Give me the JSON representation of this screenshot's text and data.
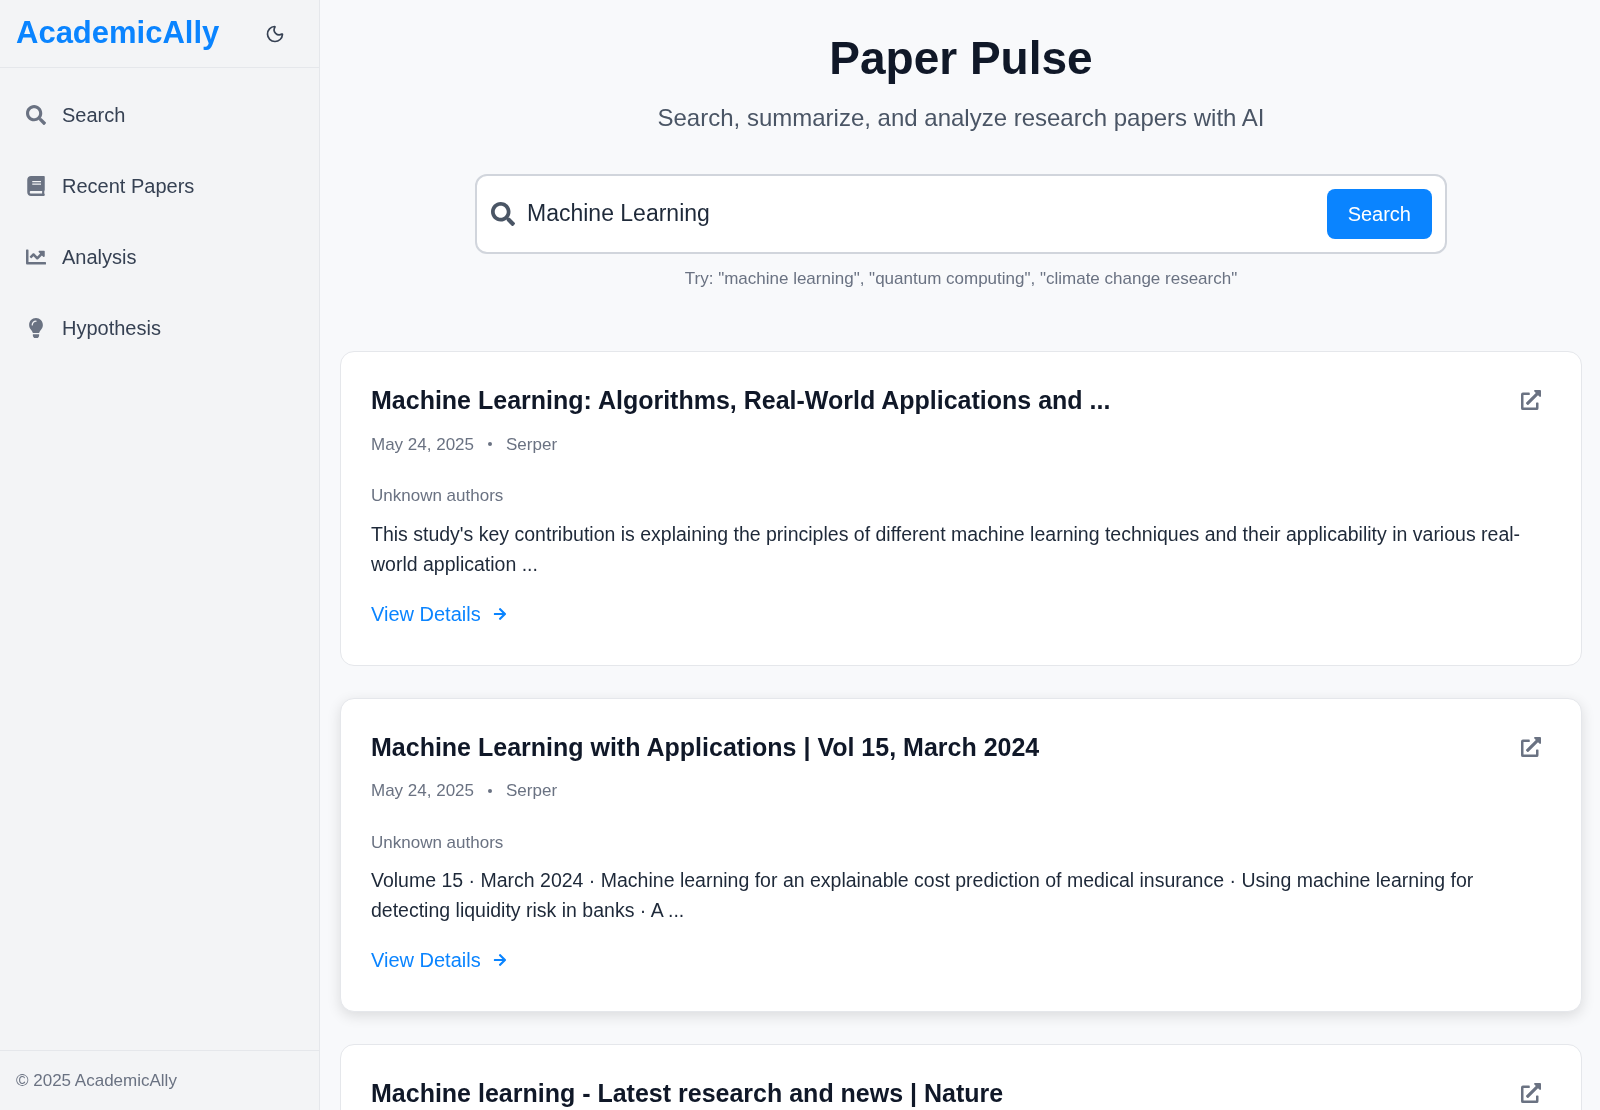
{
  "sidebar": {
    "logo": "AcademicAlly",
    "nav": [
      {
        "kind": "search",
        "label": "Search"
      },
      {
        "kind": "book",
        "label": "Recent Papers"
      },
      {
        "kind": "chart",
        "label": "Analysis"
      },
      {
        "kind": "bulb",
        "label": "Hypothesis"
      }
    ],
    "footer": "© 2025 AcademicAlly"
  },
  "header": {
    "title": "Paper Pulse",
    "subtitle": "Search, summarize, and analyze research papers with AI"
  },
  "search": {
    "value": "Machine Learning",
    "button": "Search",
    "hint": "Try: \"machine learning\", \"quantum computing\", \"climate change research\""
  },
  "results": [
    {
      "title": "Machine Learning: Algorithms, Real-World Applications and ...",
      "date": "May 24, 2025",
      "source": "Serper",
      "authors": "Unknown authors",
      "snippet": "This study's key contribution is explaining the principles of different machine learning techniques and their applicability in various real-world application ...",
      "link": "View Details",
      "raised": false
    },
    {
      "title": "Machine Learning with Applications | Vol 15, March 2024",
      "date": "May 24, 2025",
      "source": "Serper",
      "authors": "Unknown authors",
      "snippet": "Volume 15 · March 2024 · Machine learning for an explainable cost prediction of medical insurance · Using machine learning for detecting liquidity risk in banks · A ...",
      "link": "View Details",
      "raised": true
    },
    {
      "title": "Machine learning - Latest research and news | Nature",
      "raised": false
    }
  ]
}
